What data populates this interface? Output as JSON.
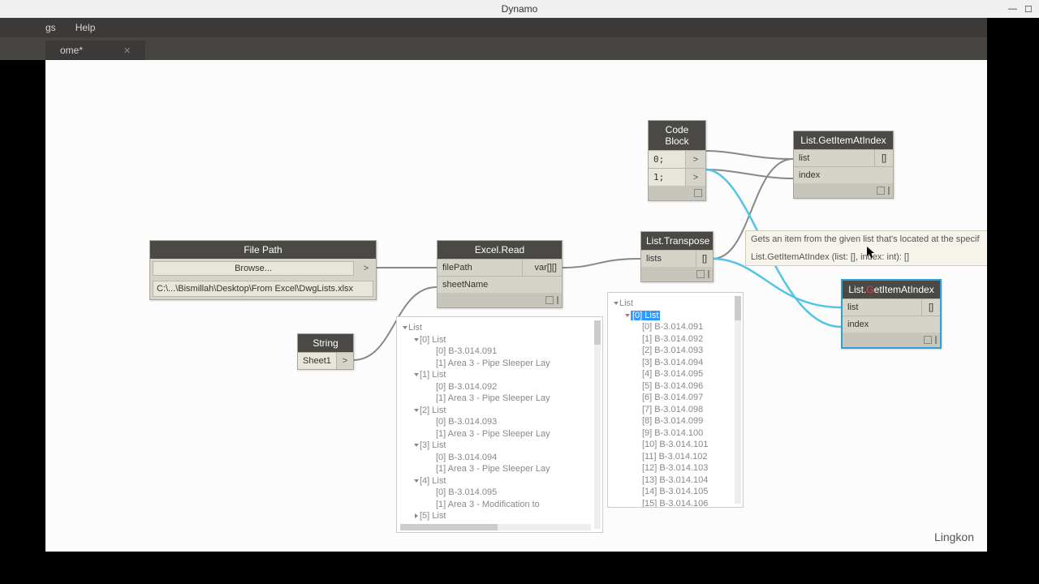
{
  "window": {
    "title": "Dynamo"
  },
  "menu": {
    "gs": "gs",
    "help": "Help"
  },
  "tab": {
    "name": "ome*"
  },
  "watermark": "Lingkon",
  "tooltip": {
    "line1": "Gets an item from the given list that's located at the specif",
    "line2": "List.GetItemAtIndex (list: [], index: int): []"
  },
  "nodes": {
    "filepath": {
      "title": "File Path",
      "browse": "Browse...",
      "path": "C:\\...\\Bismillah\\Desktop\\From Excel\\DwgLists.xlsx"
    },
    "string": {
      "title": "String",
      "value": "Sheet1"
    },
    "excel": {
      "title": "Excel.Read",
      "in1": "filePath",
      "in2": "sheetName",
      "out": "var[][]"
    },
    "codeblock": {
      "title": "Code Block",
      "line1": "0;",
      "line2": "1;"
    },
    "transpose": {
      "title": "List.Transpose",
      "in": "lists",
      "out": "[]"
    },
    "getitem1": {
      "title": "List.GetItemAtIndex",
      "in1": "list",
      "in2": "index",
      "out": "[]"
    },
    "getitem2": {
      "title": "List.GetItemAtIndex",
      "in1": "list",
      "in2": "index",
      "out": "[]"
    }
  },
  "preview_excel": {
    "root": "List",
    "groups": [
      {
        "head": "[0] List",
        "a": "[0] B-3.014.091",
        "b": "[1] Area 3 - Pipe Sleeper Lay"
      },
      {
        "head": "[1] List",
        "a": "[0] B-3.014.092",
        "b": "[1] Area 3 - Pipe Sleeper Lay"
      },
      {
        "head": "[2] List",
        "a": "[0] B-3.014.093",
        "b": "[1] Area 3 - Pipe Sleeper Lay"
      },
      {
        "head": "[3] List",
        "a": "[0] B-3.014.094",
        "b": "[1] Area 3 - Pipe Sleeper Lay"
      },
      {
        "head": "[4] List",
        "a": "[0] B-3.014.095",
        "b": "[1] Area 3 - Modification to"
      },
      {
        "head": "[5] List",
        "a": "",
        "b": ""
      }
    ]
  },
  "preview_transpose": {
    "root": "List",
    "hl": "[0] List",
    "items": [
      "[0] B-3.014.091",
      "[1] B-3.014.092",
      "[2] B-3.014.093",
      "[3] B-3.014.094",
      "[4] B-3.014.095",
      "[5] B-3.014.096",
      "[6] B-3.014.097",
      "[7] B-3.014.098",
      "[8] B-3.014.099",
      "[9] B-3.014.100",
      "[10] B-3.014.101",
      "[11] B-3.014.102",
      "[12] B-3.014.103",
      "[13] B-3.014.104",
      "[14] B-3.014.105",
      "[15] B-3.014.106"
    ]
  }
}
